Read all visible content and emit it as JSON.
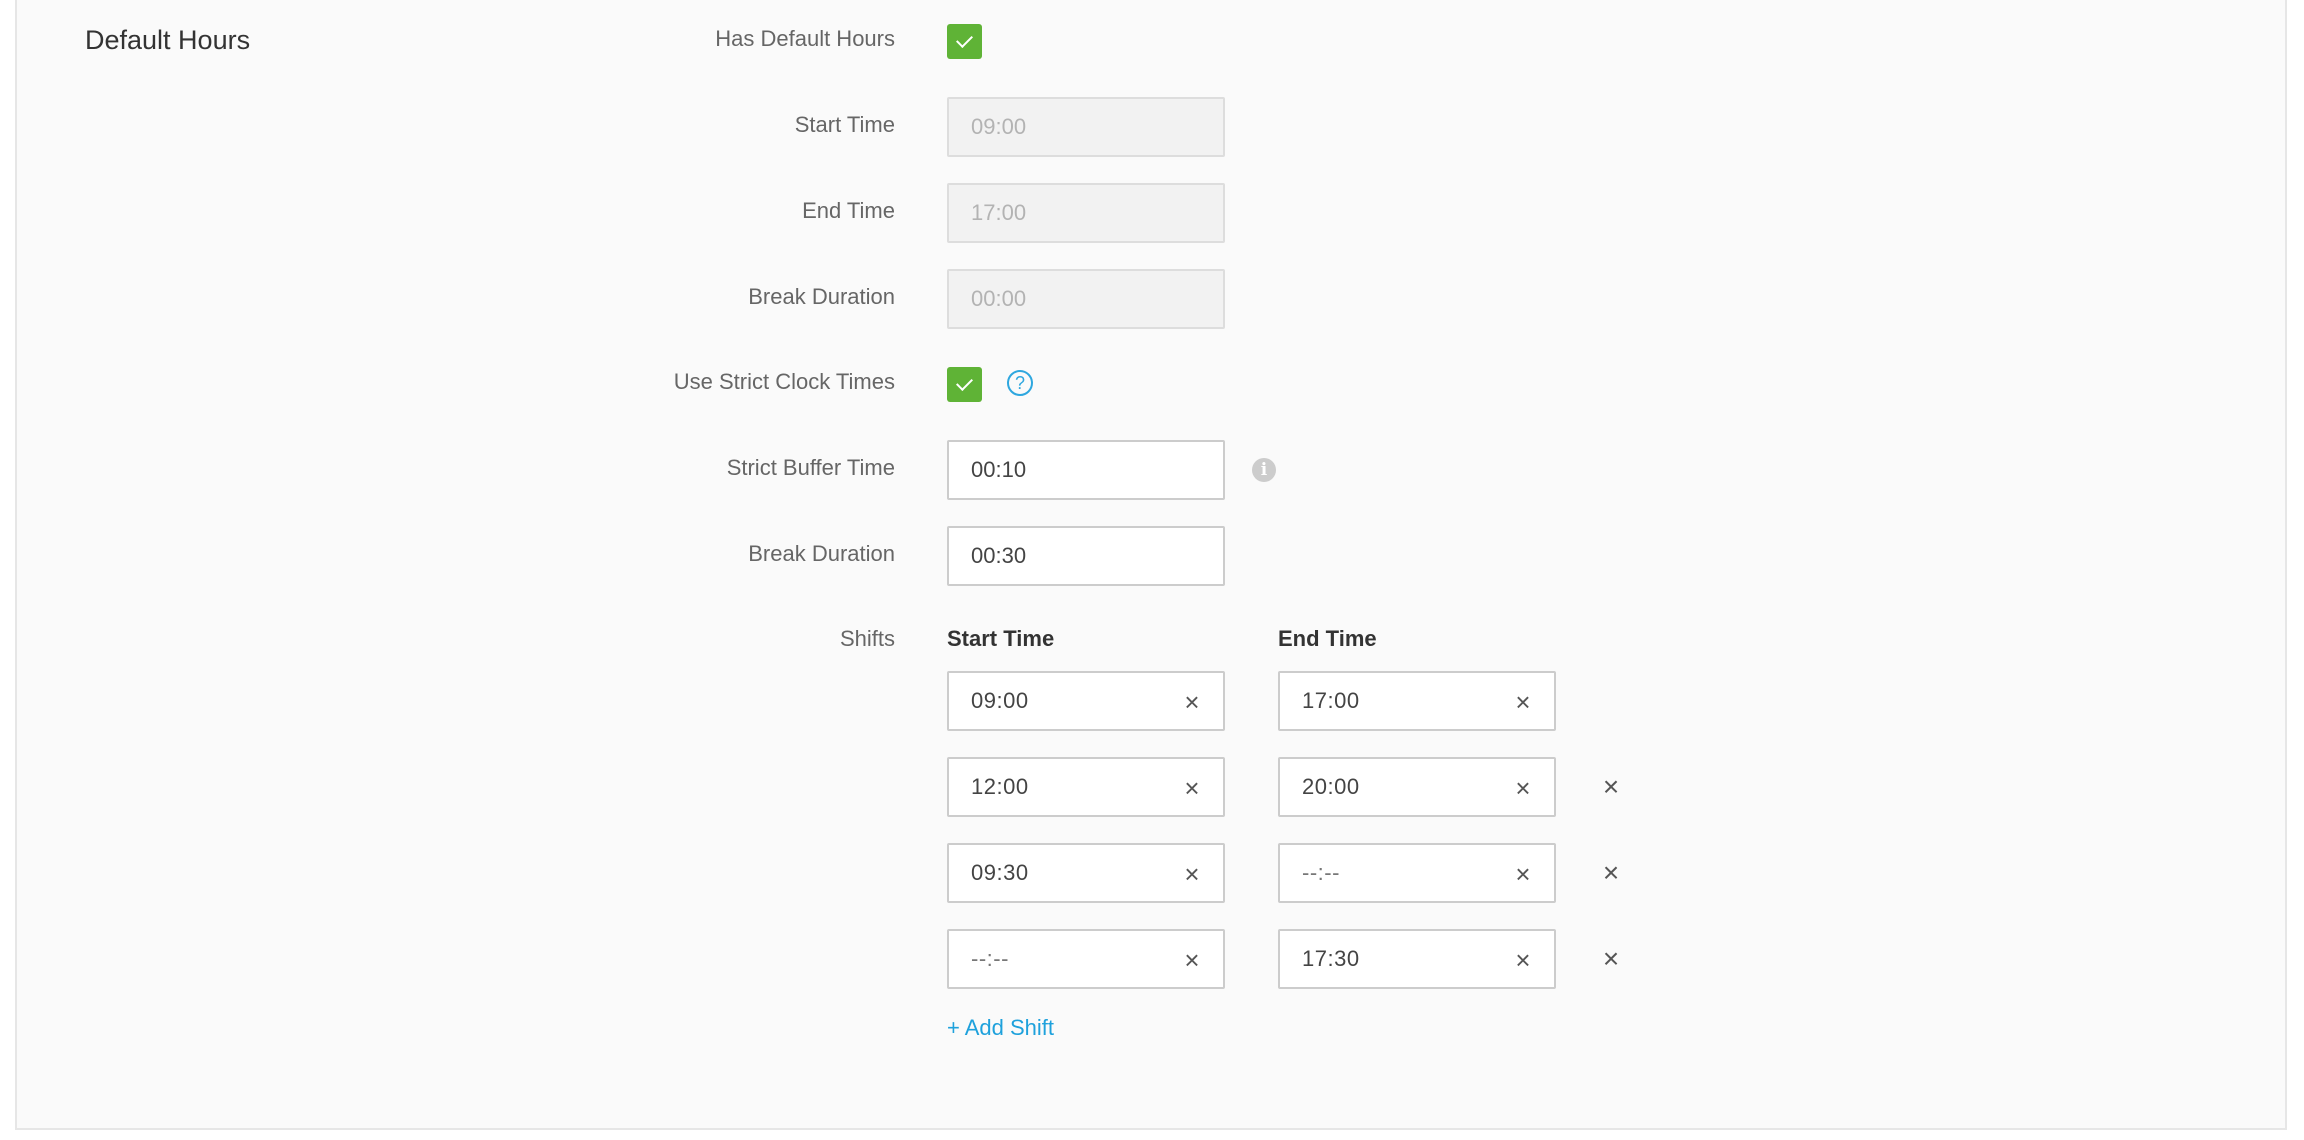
{
  "section": {
    "title": "Default Hours"
  },
  "fields": {
    "has_default_hours": {
      "label": "Has Default Hours",
      "checked": true
    },
    "start_time": {
      "label": "Start Time",
      "value": "09:00"
    },
    "end_time": {
      "label": "End Time",
      "value": "17:00"
    },
    "break_duration_default": {
      "label": "Break Duration",
      "value": "00:00"
    },
    "use_strict_clock_times": {
      "label": "Use Strict Clock Times",
      "checked": true,
      "help_icon": "question-circle-icon",
      "help_glyph": "?"
    },
    "strict_buffer_time": {
      "label": "Strict Buffer Time",
      "value": "00:10",
      "info_icon": "info-circle-icon",
      "info_glyph": "i"
    },
    "break_duration": {
      "label": "Break Duration",
      "value": "00:30"
    }
  },
  "shifts": {
    "label": "Shifts",
    "start_header": "Start Time",
    "end_header": "End Time",
    "clear_glyph": "×",
    "remove_glyph": "×",
    "rows": [
      {
        "start": "09:00",
        "end": "17:00"
      },
      {
        "start": "12:00",
        "end": "20:00"
      },
      {
        "start": "09:30",
        "end": "--:--"
      },
      {
        "start": "--:--",
        "end": "17:30"
      }
    ],
    "add_label": "+ Add Shift"
  },
  "colors": {
    "checkbox": "#5fb336",
    "link": "#1ea1dc",
    "help_icon": "#2ea7df"
  }
}
